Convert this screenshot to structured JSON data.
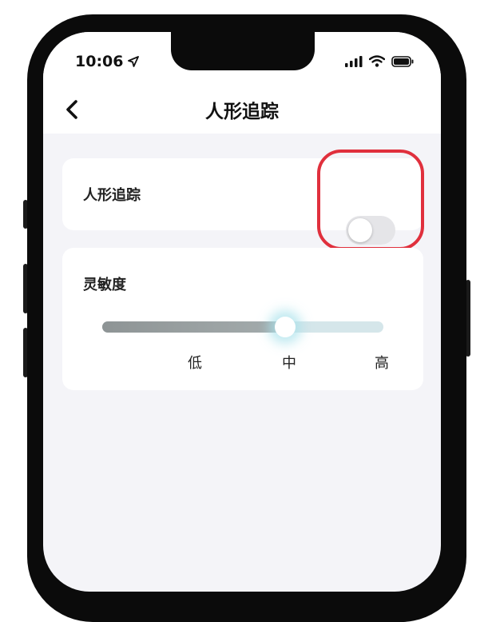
{
  "status_bar": {
    "time": "10:06"
  },
  "nav": {
    "title": "人形追踪"
  },
  "tracking_card": {
    "label": "人形追踪",
    "toggle_on": false
  },
  "sensitivity_card": {
    "label": "灵敏度",
    "levels": [
      "低",
      "中",
      "高"
    ],
    "selected": "中",
    "slider_fraction": 0.65
  },
  "colors": {
    "highlight": "#e0303d",
    "toggle_off": "#e5e5e8",
    "slider_fill": "#8e9495",
    "slider_track": "#d5e6ea"
  }
}
